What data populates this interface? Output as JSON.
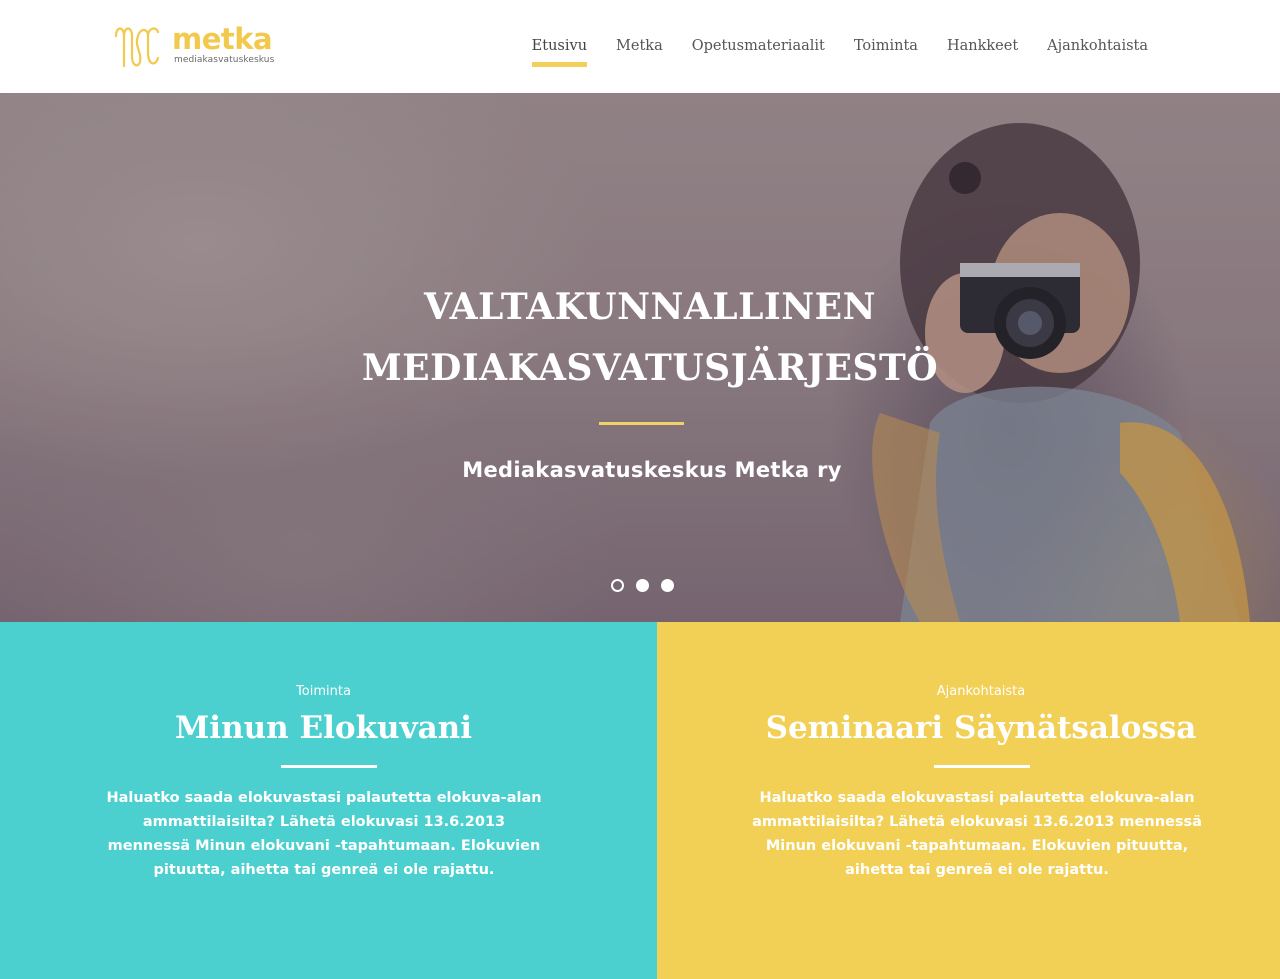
{
  "brand": {
    "name": "metka",
    "tagline": "mediakasvatuskeskus",
    "color": "#f2c94c"
  },
  "nav": {
    "items": [
      {
        "label": "Etusivu",
        "active": true
      },
      {
        "label": "Metka",
        "active": false
      },
      {
        "label": "Opetusmateriaalit",
        "active": false
      },
      {
        "label": "Toiminta",
        "active": false
      },
      {
        "label": "Hankkeet",
        "active": false
      },
      {
        "label": "Ajankohtaista",
        "active": false
      }
    ],
    "active_color": "#f2d05a"
  },
  "hero": {
    "title_line1": "VALTAKUNNALLINEN",
    "title_line2": "MEDIAKASVATUSJÄRJESTÖ",
    "subtitle": "Mediakasvatuskeskus Metka ry",
    "slides": 3,
    "current_slide": 1
  },
  "panels": [
    {
      "category": "Toiminta",
      "title": "Minun Elokuvani",
      "text": "Haluatko saada elokuvastasi palautetta elokuva-alan ammattilaisilta? Lähetä elokuvasi 13.6.2013 mennessä Minun elokuvani -tapahtumaan. Elokuvien pituutta, aihetta tai genreä ei ole rajattu.",
      "color": "#4ccfcf"
    },
    {
      "category": "Ajankohtaista",
      "title": "Seminaari Säynätsalossa",
      "text": "Haluatko saada elokuvastasi palautetta elokuva-alan ammattilaisilta? Lähetä elokuvasi 13.6.2013 mennessä Minun elokuvani -tapahtumaan. Elokuvien pituutta, aihetta tai genreä ei ole rajattu.",
      "color": "#f2cf55"
    }
  ]
}
